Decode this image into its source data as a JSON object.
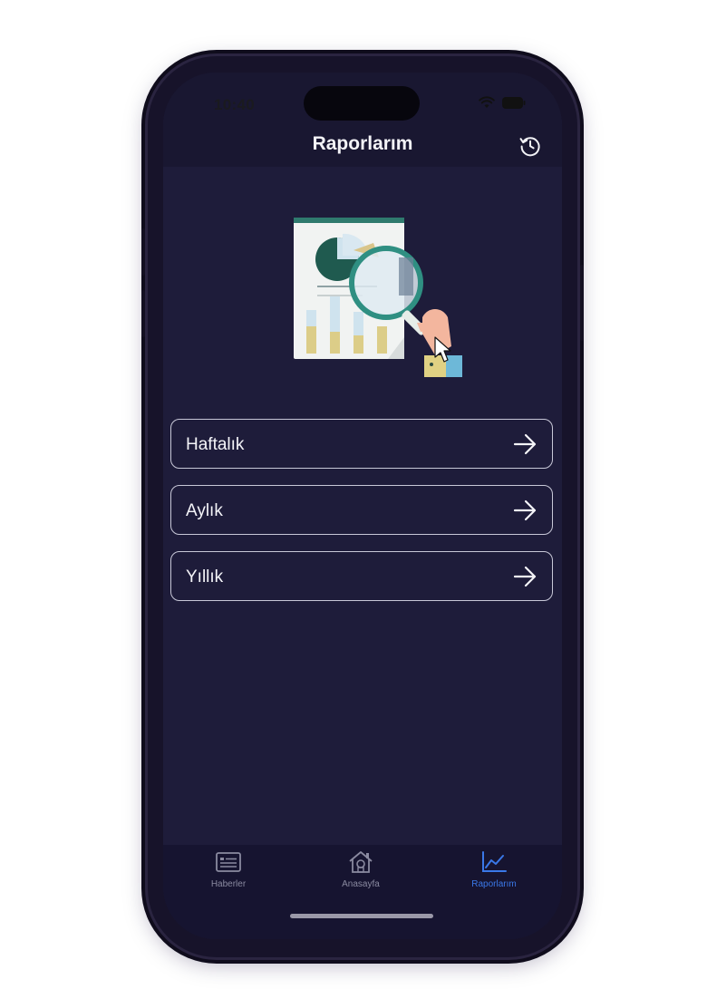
{
  "status_bar": {
    "time": "10:40"
  },
  "header": {
    "title": "Raporlarım",
    "history_icon": "history-icon"
  },
  "reports": [
    {
      "label": "Haftalık",
      "icon": "arrow-right-icon"
    },
    {
      "label": "Aylık",
      "icon": "arrow-right-icon"
    },
    {
      "label": "Yıllık",
      "icon": "arrow-right-icon"
    }
  ],
  "tabs": [
    {
      "label": "Haberler",
      "icon": "news-icon",
      "active": false
    },
    {
      "label": "Anasayfa",
      "icon": "home-icon",
      "active": false
    },
    {
      "label": "Raporlarım",
      "icon": "chart-line-icon",
      "active": true
    }
  ],
  "colors": {
    "background": "#1e1c3a",
    "accent": "#3a78e8",
    "border": "#c8c8d8"
  }
}
